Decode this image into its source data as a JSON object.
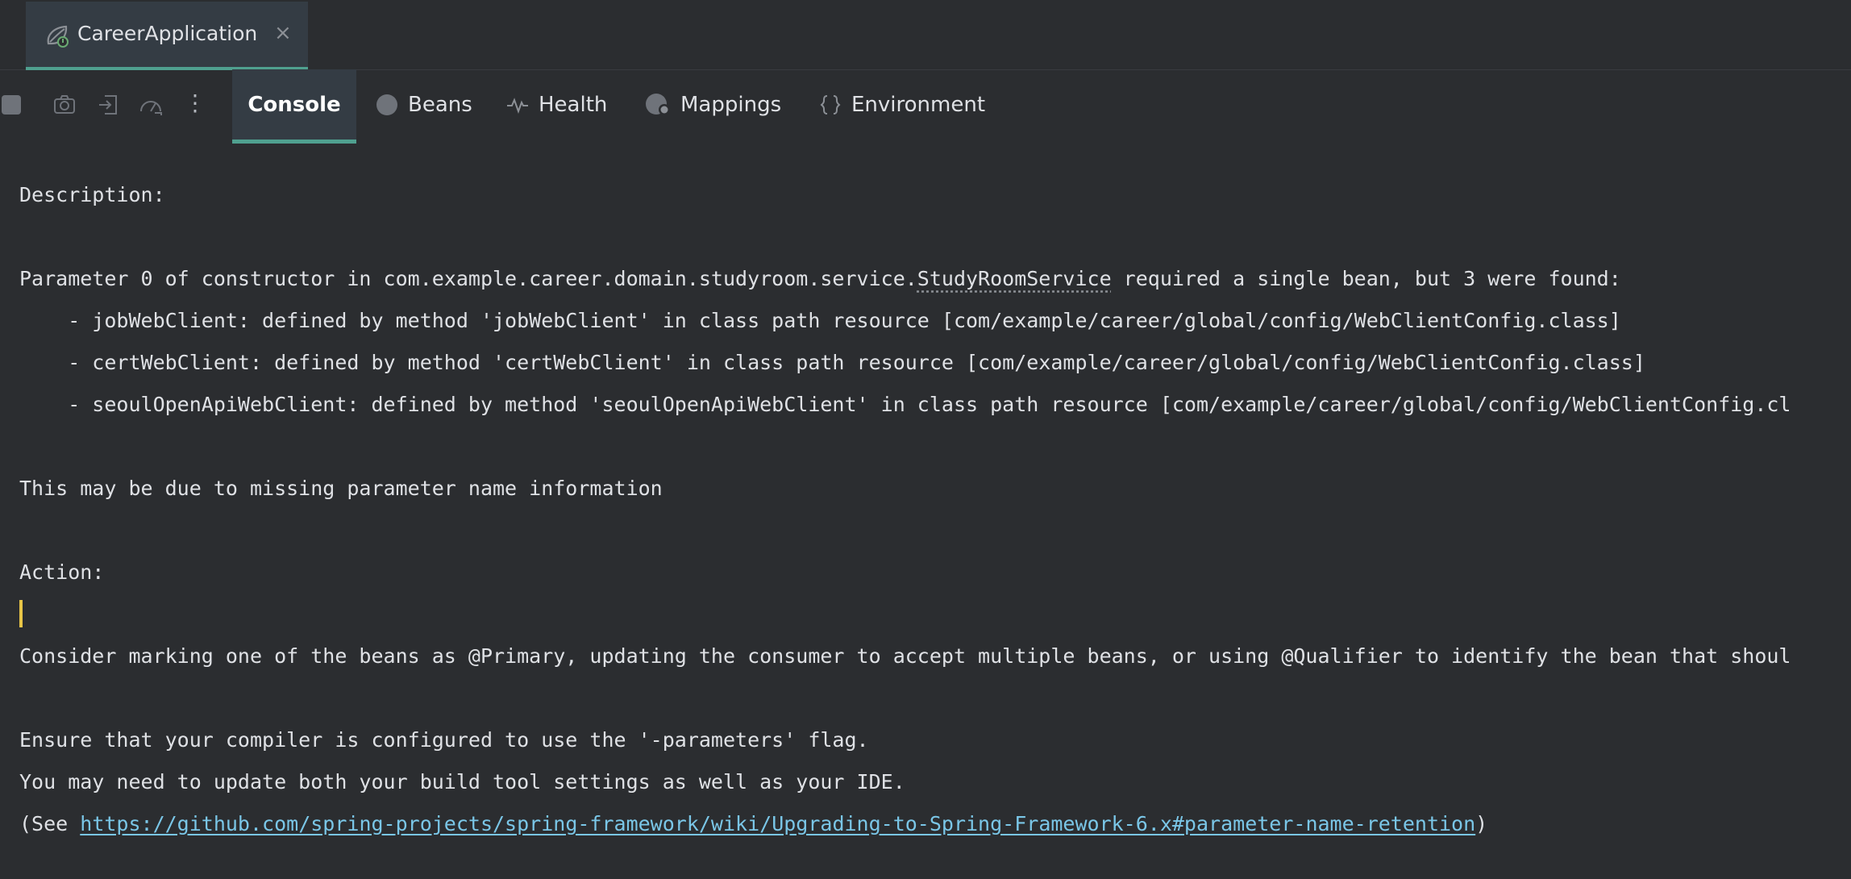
{
  "run_tab": {
    "title": "CareerApplication",
    "close": "×",
    "icon": "spring-boot-icon"
  },
  "toolbar": {
    "icons": [
      "stop-icon",
      "camera-icon",
      "login-icon",
      "speedometer-icon",
      "more-vertical-icon"
    ],
    "more_glyph": "⋮",
    "tabs": [
      {
        "label": "Console",
        "icon": "",
        "active": true
      },
      {
        "label": "Beans",
        "icon": "bean-icon"
      },
      {
        "label": "Health",
        "icon": "pulse-icon"
      },
      {
        "label": "Mappings",
        "icon": "mapping-icon"
      },
      {
        "label": "Environment",
        "icon": "braces-icon"
      }
    ]
  },
  "colors": {
    "accent": "#4fa08f",
    "link": "#7ac6e7",
    "caret": "#e8c547",
    "background": "#2b2d30"
  },
  "console": {
    "description": "Description:",
    "param_prefix": "Parameter 0 of constructor in com.example.career.domain.studyroom.service.",
    "param_class": "StudyRoomService",
    "param_suffix": " required a single bean, but 3 were found:",
    "bean1": "    - jobWebClient: defined by method 'jobWebClient' in class path resource [com/example/career/global/config/WebClientConfig.class]",
    "bean2": "    - certWebClient: defined by method 'certWebClient' in class path resource [com/example/career/global/config/WebClientConfig.class]",
    "bean3": "    - seoulOpenApiWebClient: defined by method 'seoulOpenApiWebClient' in class path resource [com/example/career/global/config/WebClientConfig.cl",
    "missing_info": "This may be due to missing parameter name information",
    "action": "Action:",
    "consider": "Consider marking one of the beans as @Primary, updating the consumer to accept multiple beans, or using @Qualifier to identify the bean that shoul",
    "ensure": "Ensure that your compiler is configured to use the '-parameters' flag.",
    "update": "You may need to update both your build tool settings as well as your IDE.",
    "see_prefix": "(See ",
    "see_link": "https://github.com/spring-projects/spring-framework/wiki/Upgrading-to-Spring-Framework-6.x#parameter-name-retention",
    "see_suffix": ")"
  }
}
